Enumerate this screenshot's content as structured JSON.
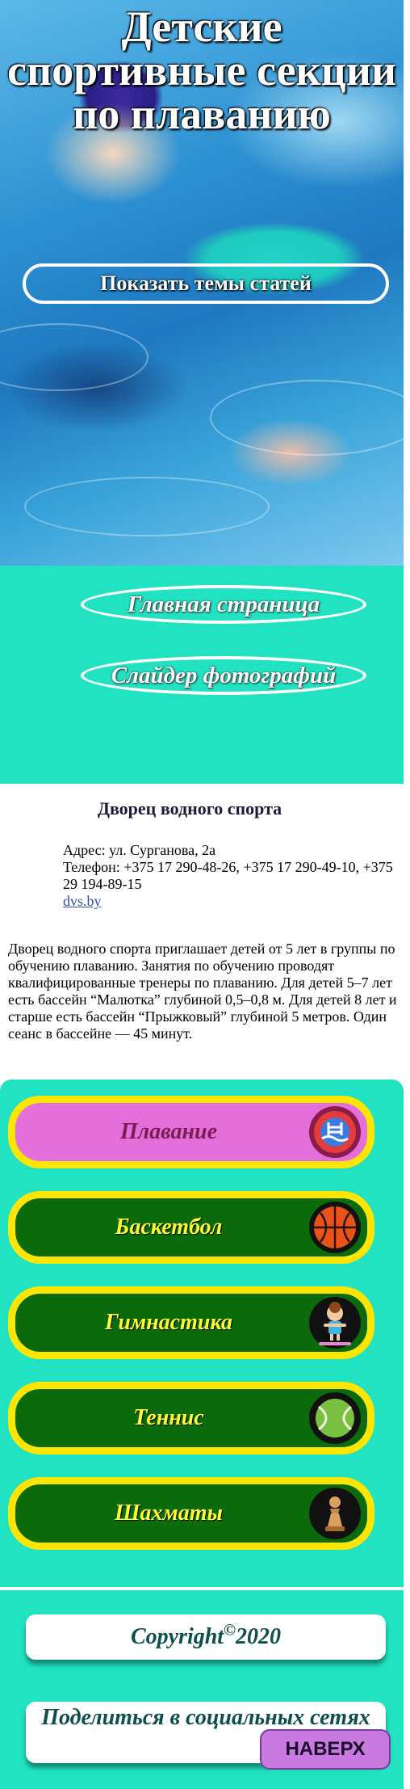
{
  "hero": {
    "title": "Детские спортивные секции по плаванию",
    "topics_button": "Показать темы статей"
  },
  "nav": {
    "main_page": "Главная страница",
    "photo_slider": "Слайдер фотографий"
  },
  "info": {
    "title": "Дворец водного спорта",
    "address": "Адрес: ул. Сурганова, 2а",
    "phone": "Телефон: +375 17 290-48-26, +375 17 290-49-10, +375 29 194-89-15",
    "site": "dvs.by",
    "description": "Дворец водного спорта приглашает детей от 5 лет в группы по обучению плаванию. Занятия по обучению проводят квалифицированные тренеры по плаванию. Для детей 5–7 лет есть бассейн “Малютка” глубиной 0,5–0,8 м. Для детей 8 лет и старше есть бассейн “Прыжковый” глубиной 5 метров. Один сеанс в бассейне — 45 минут."
  },
  "sports": [
    {
      "label": "Плавание",
      "icon": "swimming-pool-icon",
      "active": true
    },
    {
      "label": "Баскетбол",
      "icon": "basketball-icon",
      "active": false
    },
    {
      "label": "Гимнастика",
      "icon": "gymnast-icon",
      "active": false
    },
    {
      "label": "Теннис",
      "icon": "tennis-ball-icon",
      "active": false
    },
    {
      "label": "Шахматы",
      "icon": "chess-pawn-icon",
      "active": false
    }
  ],
  "footer": {
    "copyright_text": "Copyright",
    "copyright_symbol": "©",
    "copyright_year": "2020",
    "share": "Поделиться в социальных сетях",
    "top_button": "НАВЕРХ"
  },
  "colors": {
    "accent": "#21e3c2",
    "sport_bg": "#0b6b0b",
    "sport_border": "#ffe600",
    "active_sport_bg": "#e46fda"
  }
}
